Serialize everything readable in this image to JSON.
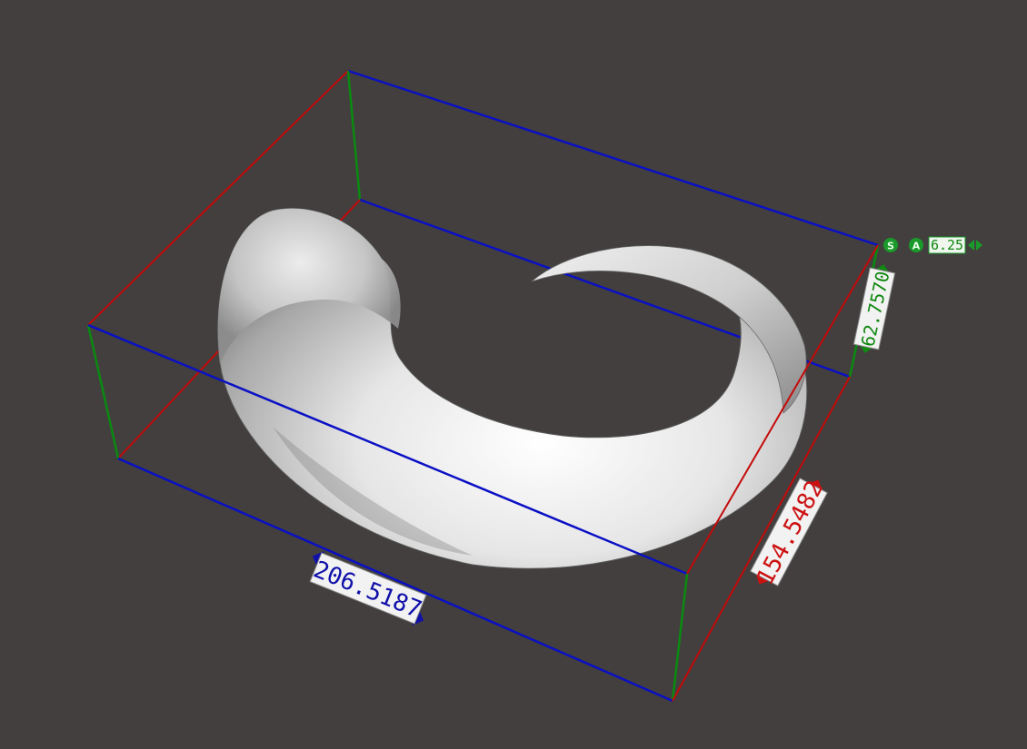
{
  "viewport": {
    "background_color": "#423f3e",
    "axis_colors": {
      "x": "#0a10c4",
      "y": "#c40a0a",
      "z": "#0a8a10"
    }
  },
  "model": {
    "shape": "curled-horn-mesh",
    "surface_color": "#d9d9d9"
  },
  "dimensions": {
    "length": {
      "value": "206.5187",
      "color": "#1111aa"
    },
    "width": {
      "value": "154.5482",
      "color": "#cc1111"
    },
    "height": {
      "value": "62.7570",
      "color": "#118811"
    }
  },
  "controls": {
    "snap_label": "S",
    "angle_label": "A",
    "step_value": "6.25",
    "decrease_icon": "triangle-left-icon",
    "increase_icon": "triangle-right-icon"
  }
}
